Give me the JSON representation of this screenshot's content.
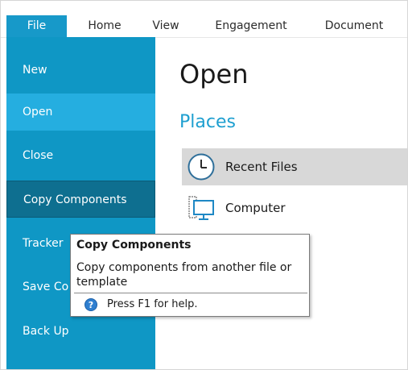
{
  "ribbon": {
    "tabs": [
      {
        "label": "File"
      },
      {
        "label": "Home"
      },
      {
        "label": "View"
      },
      {
        "label": "Engagement"
      },
      {
        "label": "Document"
      }
    ]
  },
  "nav": {
    "items": [
      {
        "label": "New"
      },
      {
        "label": "Open"
      },
      {
        "label": "Close"
      },
      {
        "label": "Copy Components"
      },
      {
        "label": "Tracker"
      },
      {
        "label": "Save Co"
      },
      {
        "label": "Back Up"
      }
    ]
  },
  "main": {
    "title": "Open",
    "places_heading": "Places",
    "places": [
      {
        "label": "Recent Files",
        "icon": "clock-icon"
      },
      {
        "label": "Computer",
        "icon": "computer-icon"
      }
    ]
  },
  "tooltip": {
    "title": "Copy Components",
    "body": "Copy components from another file or template",
    "help": "Press F1 for help.",
    "help_icon": "question-icon"
  },
  "colors": {
    "accent": "#1799c9",
    "nav_bg": "#0f97c5",
    "nav_selected": "#25aee0",
    "nav_hover": "#0e6f90",
    "places_heading": "#1e9fd0",
    "recent_row_bg": "#d8d8d8"
  }
}
